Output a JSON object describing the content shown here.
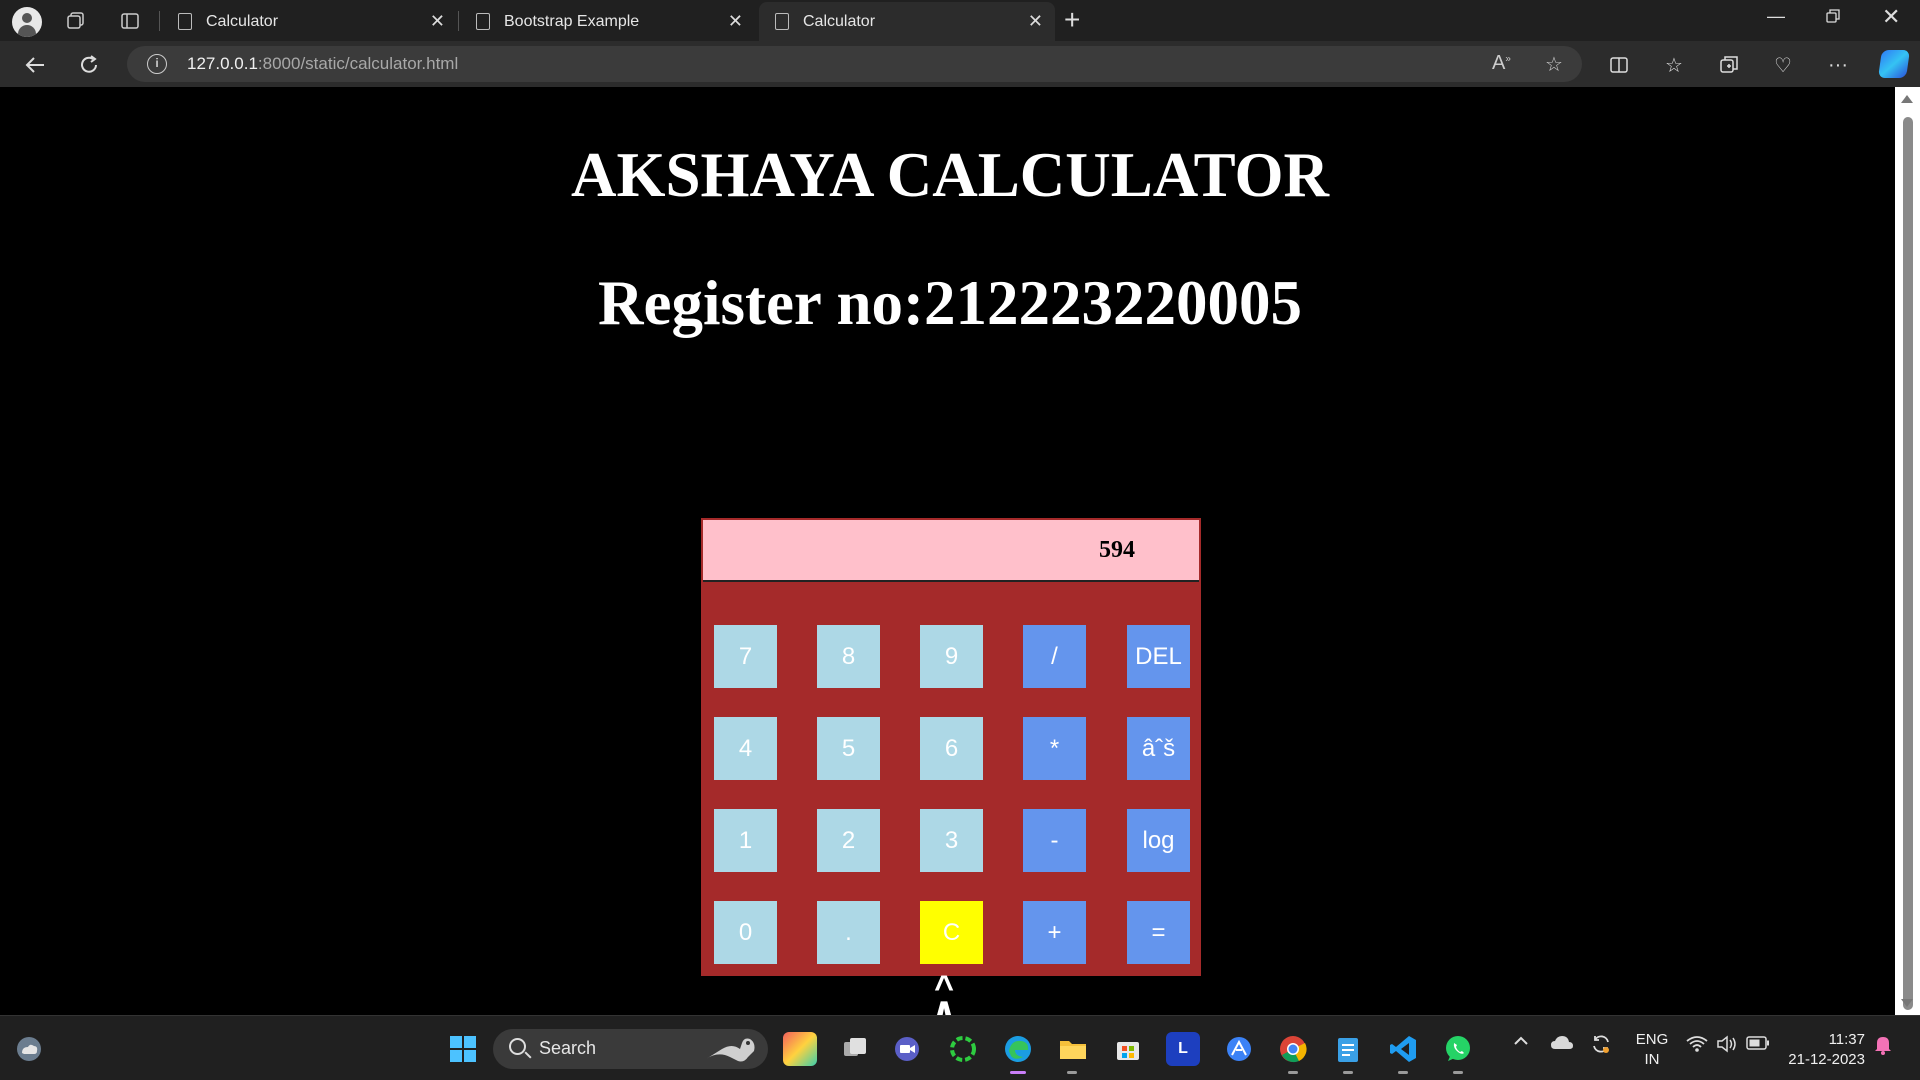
{
  "browser": {
    "tabs": [
      {
        "title": "Calculator"
      },
      {
        "title": "Bootstrap Example"
      },
      {
        "title": "Calculator"
      }
    ],
    "url_host": "127.0.0.1",
    "url_path": ":8000/static/calculator.html"
  },
  "page": {
    "title": "AKSHAYA CALCULATOR",
    "subtitle": "Register no:212223220005"
  },
  "calculator": {
    "display_value": "594",
    "keys": {
      "k7": "7",
      "k8": "8",
      "k9": "9",
      "div": "/",
      "del": "DEL",
      "k4": "4",
      "k5": "5",
      "k6": "6",
      "mul": "*",
      "sqrt": "âˆš",
      "k1": "1",
      "k2": "2",
      "k3": "3",
      "sub": "-",
      "log": "log",
      "k0": "0",
      "dot": ".",
      "clear": "C",
      "add": "+",
      "eq": "="
    },
    "colors": {
      "body": "#a52a2a",
      "display": "#ffc0cb",
      "number_key": "#add8e6",
      "operator_key": "#6495ed",
      "clear_key": "#ffff00"
    }
  },
  "taskbar": {
    "search_label": "Search",
    "language": "ENG",
    "region": "IN",
    "time": "11:37",
    "date": "21-12-2023"
  }
}
